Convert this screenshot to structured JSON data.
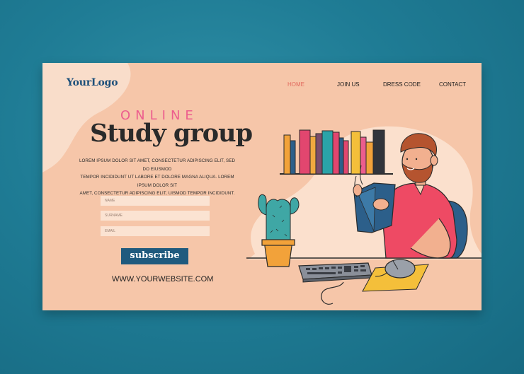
{
  "brand": {
    "logo": "YourLogo"
  },
  "nav": {
    "items": [
      {
        "label": "HOME",
        "active": true
      },
      {
        "label": "JOIN US",
        "active": false
      },
      {
        "label": "DRESS CODE",
        "active": false
      },
      {
        "label": "CONTACT",
        "active": false
      }
    ]
  },
  "hero": {
    "kicker": "ONLINE",
    "title": "Study group",
    "body": [
      "LOREM IPSUM DOLOR SIT AMET, CONSECTETUR ADIPISCING ELIT, SED DO EIUSMOD",
      "TEMPOR INCIDIDUNT UT LABORE ET DOLORE MAGNA ALIQUA. LOREM IPSUM DOLOR SIT",
      "AMET, CONSECTETUR ADIPISCING ELIT, UISMOD TEMPOR INCIDIDUNT."
    ]
  },
  "form": {
    "name_placeholder": "NAME",
    "surname_placeholder": "SURNAME",
    "email_placeholder": "EMAIL",
    "subscribe_label": "subscribe"
  },
  "footer": {
    "website": "WWW.YOURWEBSITE.COM"
  },
  "colors": {
    "background": "#1f7c95",
    "card": "#f6c6a9",
    "accent_pink": "#ec5d8e",
    "button": "#1f5a7e",
    "logo": "#1c4f7a"
  },
  "illustration": {
    "icons": [
      "bookshelf-books",
      "reading-man",
      "cactus-pot",
      "keyboard",
      "mouse",
      "mouse-pad"
    ]
  }
}
